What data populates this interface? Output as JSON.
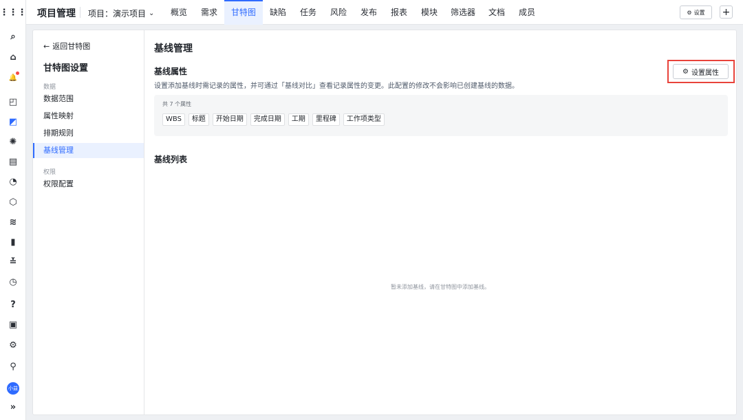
{
  "rail": {
    "icons": [
      {
        "name": "apps-grid-icon",
        "glyph": "⋮⋮⋮",
        "active": false
      },
      {
        "name": "search-icon",
        "glyph": "⌕",
        "active": false
      },
      {
        "name": "home-icon",
        "glyph": "⌂",
        "active": false
      },
      {
        "name": "bell-icon",
        "glyph": "🔔",
        "active": false
      },
      {
        "name": "document-icon",
        "glyph": "◰",
        "active": false
      },
      {
        "name": "project-icon",
        "glyph": "◩",
        "active": true
      },
      {
        "name": "bug-icon",
        "glyph": "✺",
        "active": false
      },
      {
        "name": "wiki-icon",
        "glyph": "▤",
        "active": false
      },
      {
        "name": "dashboard-icon",
        "glyph": "◔",
        "active": false
      },
      {
        "name": "cube-icon",
        "glyph": "⬡",
        "active": false
      },
      {
        "name": "sleep-icon",
        "glyph": "≋",
        "active": false
      },
      {
        "name": "bar-chart-icon",
        "glyph": "▮",
        "active": false
      },
      {
        "name": "checklist-icon",
        "glyph": "≚",
        "active": false
      },
      {
        "name": "clock-icon",
        "glyph": "◷",
        "active": false
      },
      {
        "name": "help-icon",
        "glyph": "?",
        "active": false
      },
      {
        "name": "inbox-icon",
        "glyph": "▣",
        "active": false
      },
      {
        "name": "gear-icon",
        "glyph": "⚙",
        "active": false
      },
      {
        "name": "add-user-icon",
        "glyph": "⚲",
        "active": false
      }
    ],
    "avatar": "小益",
    "expand": "»"
  },
  "topbar": {
    "app_title": "项目管理",
    "project_select": "项目：演示项目",
    "tabs": [
      {
        "label": "概览",
        "active": false
      },
      {
        "label": "需求",
        "active": false
      },
      {
        "label": "甘特图",
        "active": true
      },
      {
        "label": "缺陷",
        "active": false
      },
      {
        "label": "任务",
        "active": false
      },
      {
        "label": "风险",
        "active": false
      },
      {
        "label": "发布",
        "active": false
      },
      {
        "label": "报表",
        "active": false
      },
      {
        "label": "模块",
        "active": false
      },
      {
        "label": "筛选器",
        "active": false
      },
      {
        "label": "文档",
        "active": false
      },
      {
        "label": "成员",
        "active": false
      }
    ],
    "settings_label": "设置",
    "plus_label": "+"
  },
  "sidebar": {
    "back_label": "返回甘特图",
    "title": "甘特图设置",
    "group_data": "数据",
    "group_perm": "权限",
    "items": [
      {
        "label": "数据范围"
      },
      {
        "label": "属性映射"
      },
      {
        "label": "排期规则"
      },
      {
        "label": "基线管理"
      },
      {
        "label": "权限配置"
      }
    ]
  },
  "main": {
    "page_title": "基线管理",
    "attr_section_title": "基线属性",
    "attr_desc": "设置添加基线时需记录的属性，并可通过「基线对比」查看记录属性的变更。此配置的修改不会影响已创建基线的数据。",
    "attr_button": "设置属性",
    "attr_count": "共 7 个属性",
    "attributes": [
      "WBS",
      "标题",
      "开始日期",
      "完成日期",
      "工期",
      "里程碑",
      "工作项类型"
    ],
    "list_section_title": "基线列表",
    "empty_text": "暂未添加基线，请在甘特图中添加基线。"
  },
  "colors": {
    "accent": "#2f6bff",
    "highlight_frame": "#e8423a"
  }
}
